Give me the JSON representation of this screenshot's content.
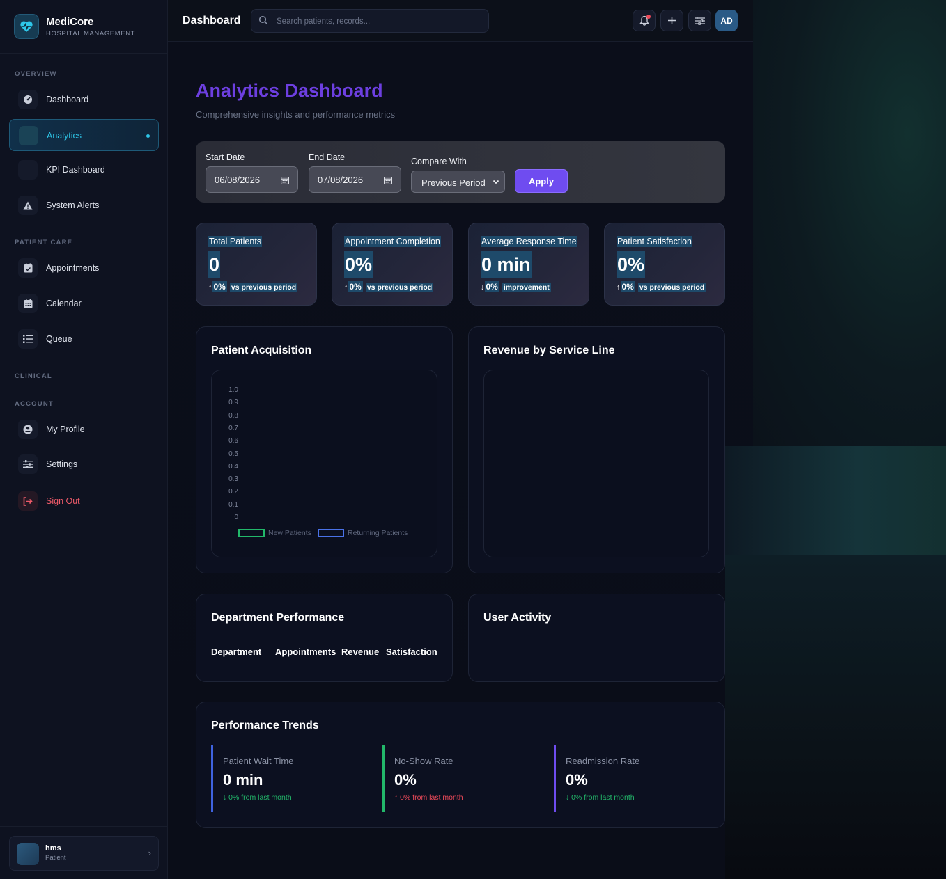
{
  "brand": {
    "name": "MediCore",
    "subtitle": "HOSPITAL MANAGEMENT"
  },
  "sidebar": {
    "sections": {
      "overview": "OVERVIEW",
      "patient_care": "PATIENT CARE",
      "clinical": "CLINICAL",
      "account": "ACCOUNT"
    },
    "items": {
      "dashboard": "Dashboard",
      "analytics": "Analytics",
      "kpi": "KPI Dashboard",
      "alerts": "System Alerts",
      "appointments": "Appointments",
      "calendar": "Calendar",
      "queue": "Queue",
      "profile": "My Profile",
      "settings": "Settings",
      "signout": "Sign Out"
    },
    "user": {
      "name": "hms",
      "role": "Patient"
    }
  },
  "topbar": {
    "title": "Dashboard",
    "search_placeholder": "Search patients, records...",
    "avatar_initials": "AD"
  },
  "page": {
    "title": "Analytics Dashboard",
    "subtitle": "Comprehensive insights and performance metrics"
  },
  "filters": {
    "start_label": "Start Date",
    "start_value": "06/08/2026",
    "end_label": "End Date",
    "end_value": "07/08/2026",
    "compare_label": "Compare With",
    "compare_value": "Previous Period",
    "apply_label": "Apply"
  },
  "kpis": [
    {
      "label": "Total Patients",
      "value": "0",
      "arrow": "↑",
      "pct": "0%",
      "context": "vs previous period"
    },
    {
      "label": "Appointment Completion",
      "value": "0%",
      "arrow": "↑",
      "pct": "0%",
      "context": "vs previous period"
    },
    {
      "label": "Average Response Time",
      "value": "0 min",
      "arrow": "↓",
      "pct": "0%",
      "context": "improvement"
    },
    {
      "label": "Patient Satisfaction",
      "value": "0%",
      "arrow": "↑",
      "pct": "0%",
      "context": "vs previous period"
    }
  ],
  "acquisition": {
    "title": "Patient Acquisition",
    "yticks": [
      "1.0",
      "0.9",
      "0.8",
      "0.7",
      "0.6",
      "0.5",
      "0.4",
      "0.3",
      "0.2",
      "0.1",
      "0"
    ],
    "legend": [
      {
        "name": "New Patients",
        "color": "#22b86a"
      },
      {
        "name": "Returning Patients",
        "color": "#4a72e8"
      }
    ]
  },
  "chart_data": {
    "type": "line",
    "title": "",
    "xlabel": "",
    "ylabel": "",
    "ylim": [
      0,
      1.0
    ],
    "categories": [],
    "series": [
      {
        "name": "New Patients",
        "values": []
      },
      {
        "name": "Returning Patients",
        "values": []
      }
    ],
    "legend": "bottom",
    "grid": false
  },
  "revenue": {
    "title": "Revenue by Service Line"
  },
  "department": {
    "title": "Department Performance",
    "columns": [
      "Department",
      "Appointments",
      "Revenue",
      "Satisfaction"
    ]
  },
  "activity": {
    "title": "User Activity"
  },
  "trends": {
    "title": "Performance Trends",
    "items": [
      {
        "label": "Patient Wait Time",
        "value": "0 min",
        "change": "↓ 0% from last month",
        "bar_color": "#3f63e0",
        "change_color": "#22b86a"
      },
      {
        "label": "No-Show Rate",
        "value": "0%",
        "change": "↑ 0% from last month",
        "bar_color": "#22b86a",
        "change_color": "#ef4a5a"
      },
      {
        "label": "Readmission Rate",
        "value": "0%",
        "change": "↓ 0% from last month",
        "bar_color": "#6f4cf0",
        "change_color": "#22b86a"
      }
    ]
  }
}
